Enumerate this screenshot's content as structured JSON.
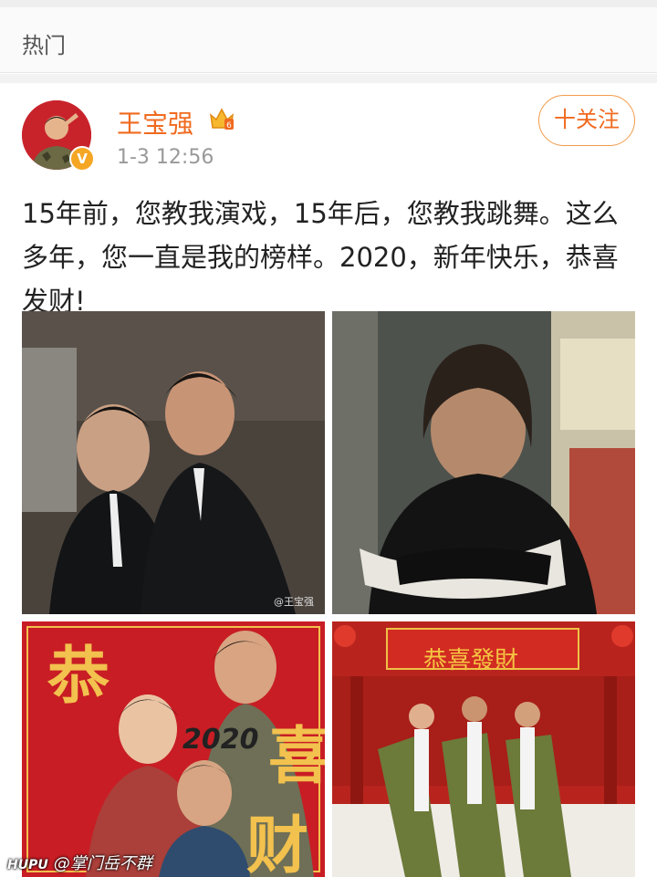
{
  "tab": {
    "label": "热门"
  },
  "post": {
    "user_name": "王宝强",
    "time": "1-3 12:56",
    "follow_label": "十关注",
    "text": "15年前，您教我演戏，15年后，您教我跳舞。这么多年，您一直是我的榜样。2020，新年快乐，恭喜发财!"
  },
  "photos": {
    "photo1": {
      "watermark": "@王宝强"
    },
    "photo3": {
      "char1": "恭",
      "char2": "喜",
      "char3": "财",
      "year": "2020"
    },
    "photo4": {
      "banner": "恭喜發財"
    }
  },
  "footer": {
    "site": "HUPU",
    "author": "@掌门岳不群"
  },
  "colors": {
    "accent": "#f06a1f",
    "badge": "#f5a623",
    "red": "#c81d24"
  }
}
